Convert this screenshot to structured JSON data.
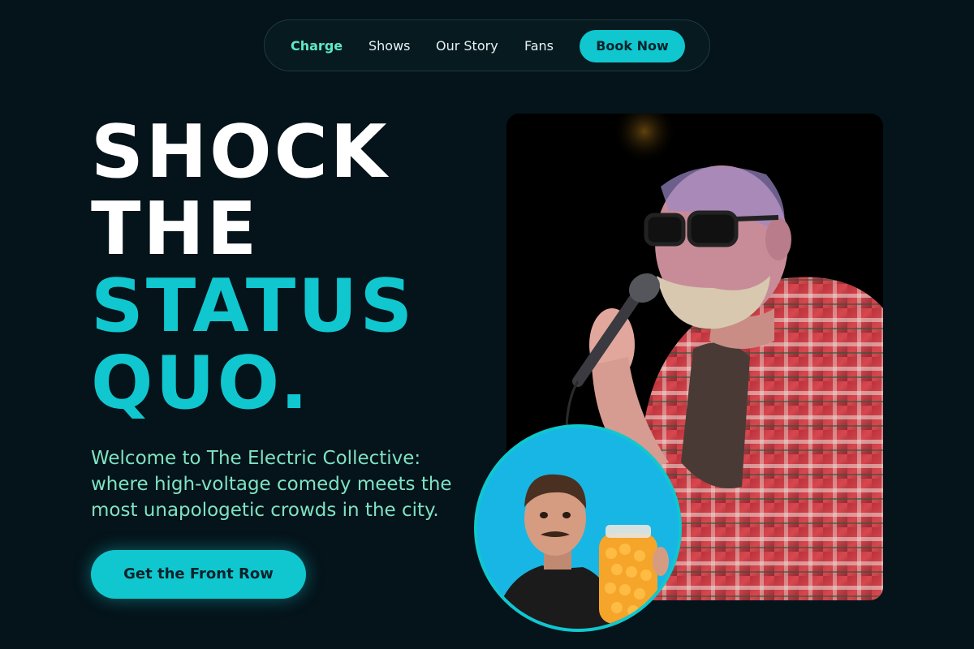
{
  "nav": {
    "items": [
      {
        "label": "Charge",
        "active": true
      },
      {
        "label": "Shows",
        "active": false
      },
      {
        "label": "Our Story",
        "active": false
      },
      {
        "label": "Fans",
        "active": false
      }
    ],
    "cta_label": "Book Now"
  },
  "hero": {
    "headline_line1": "SHOCK",
    "headline_line2": "THE",
    "headline_line3": "STATUS",
    "headline_line4": "QUO.",
    "subtitle": "Welcome to The Electric Collective: where high-voltage comedy meets the most unapologetic crowds in the city.",
    "cta_label": "Get the Front Row"
  },
  "images": {
    "main_photo_icon": "comedian-with-microphone-photo",
    "round_photo_icon": "comedian-with-candy-jar-photo"
  },
  "colors": {
    "background": "#05131a",
    "accent": "#10c7cf",
    "active_nav": "#5ee8c8",
    "subtitle": "#7fe3c2"
  }
}
